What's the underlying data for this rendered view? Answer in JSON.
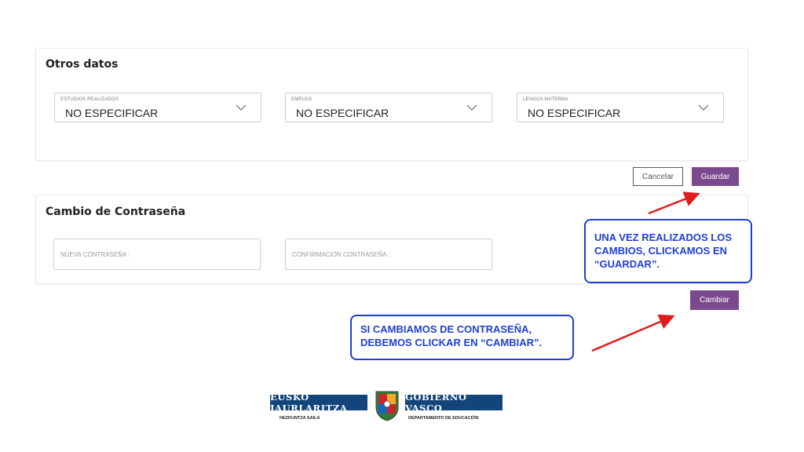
{
  "otros_datos": {
    "title": "Otros datos",
    "fields": [
      {
        "label": "ESTUDIOS REALIZADOS",
        "value": "NO ESPECIFICAR"
      },
      {
        "label": "EMPLEO",
        "value": "NO ESPECIFICAR"
      },
      {
        "label": "LENGUA MATERNA",
        "value": "NO ESPECIFICAR"
      }
    ]
  },
  "actions": {
    "cancel_label": "Cancelar",
    "save_label": "Guardar"
  },
  "password": {
    "title": "Cambio de Contraseña",
    "new_placeholder": "NUEVA CONTRASEÑA :",
    "confirm_placeholder": "CONFIRMACIÓN CONTRASEÑA :",
    "change_label": "Cambiar"
  },
  "annotations": {
    "save_note": [
      "UNA VEZ REALIZADOS LOS",
      "CAMBIOS, CLICKAMOS EN",
      "“GUARDAR”."
    ],
    "change_note": [
      "SI CAMBIAMOS DE CONTRASEÑA,",
      "DEBEMOS CLICKAR EN “CAMBIAR”."
    ]
  },
  "logo": {
    "left_name": "EUSKO JAURLARITZA",
    "right_name": "GOBIERNO VASCO",
    "left_sub": "HEZKUNTZA SAILA",
    "right_sub": "DEPARTAMENTO DE EDUCACIÓN"
  },
  "colors": {
    "primary": "#7b4a8e",
    "annotation_blue": "#1f3fd1",
    "arrow_red": "#e11b1b",
    "logo_blue": "#14457a"
  }
}
